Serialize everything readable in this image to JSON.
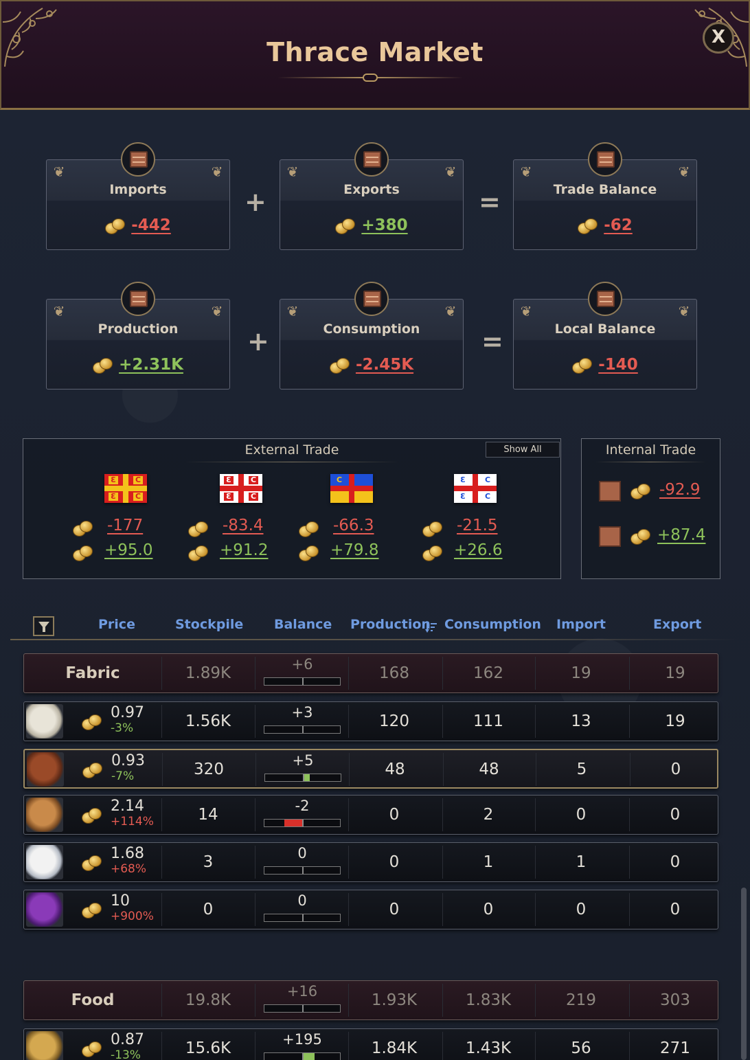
{
  "window": {
    "title": "Thrace Market",
    "close_label": "X"
  },
  "summary": {
    "row1": [
      {
        "label": "Imports",
        "value": "-442",
        "sign": "neg"
      },
      {
        "label": "Exports",
        "value": "+380",
        "sign": "pos"
      },
      {
        "label": "Trade Balance",
        "value": "-62",
        "sign": "neg"
      }
    ],
    "row2": [
      {
        "label": "Production",
        "value": "+2.31K",
        "sign": "pos"
      },
      {
        "label": "Consumption",
        "value": "-2.45K",
        "sign": "neg"
      },
      {
        "label": "Local Balance",
        "value": "-140",
        "sign": "neg"
      }
    ],
    "op_plus": "+",
    "op_equals": "="
  },
  "external_trade": {
    "title": "External Trade",
    "show_all_label": "Show All",
    "partners": [
      {
        "flag": "red-cross-gold-flag",
        "import": "-177",
        "export": "+95.0"
      },
      {
        "flag": "white-cross-red-flag",
        "import": "-83.4",
        "export": "+91.2"
      },
      {
        "flag": "red-cross-blue-yellow-flag",
        "import": "-66.3",
        "export": "+79.8"
      },
      {
        "flag": "red-cross-white-eagle-flag",
        "import": "-21.5",
        "export": "+26.6"
      }
    ]
  },
  "internal_trade": {
    "title": "Internal Trade",
    "import": "-92.9",
    "export": "+87.4"
  },
  "table": {
    "headers": {
      "price": "Price",
      "stockpile": "Stockpile",
      "balance": "Balance",
      "production": "Production",
      "consumption": "Consumption",
      "import": "Import",
      "export": "Export"
    },
    "sort_icon": "sort-descending-icon",
    "rows": [
      {
        "kind": "category",
        "name": "Fabric",
        "stockpile": "1.89K",
        "balance": "+6",
        "production": "168",
        "consumption": "162",
        "import": "19",
        "export": "19",
        "balance_fill": 0
      },
      {
        "kind": "good",
        "icon": "wool-icon",
        "price": "0.97",
        "change": "-3%",
        "change_dir": "down",
        "stockpile": "1.56K",
        "balance": "+3",
        "production": "120",
        "consumption": "111",
        "import": "13",
        "export": "19",
        "balance_fill": 0
      },
      {
        "kind": "good",
        "icon": "leather-icon",
        "price": "0.93",
        "change": "-7%",
        "change_dir": "down",
        "stockpile": "320",
        "balance": "+5",
        "production": "48",
        "consumption": "48",
        "import": "5",
        "export": "0",
        "balance_fill": 0.08,
        "selected": true
      },
      {
        "kind": "good",
        "icon": "fur-icon",
        "price": "2.14",
        "change": "+114%",
        "change_dir": "up",
        "stockpile": "14",
        "balance": "-2",
        "production": "0",
        "consumption": "2",
        "import": "0",
        "export": "0",
        "balance_fill": -0.25
      },
      {
        "kind": "good",
        "icon": "cotton-icon",
        "price": "1.68",
        "change": "+68%",
        "change_dir": "up",
        "stockpile": "3",
        "balance": "0",
        "production": "0",
        "consumption": "1",
        "import": "1",
        "export": "0",
        "balance_fill": 0
      },
      {
        "kind": "good",
        "icon": "silk-icon",
        "price": "10",
        "change": "+900%",
        "change_dir": "up",
        "stockpile": "0",
        "balance": "0",
        "production": "0",
        "consumption": "0",
        "import": "0",
        "export": "0",
        "balance_fill": 0
      },
      {
        "kind": "category",
        "name": "Food",
        "stockpile": "19.8K",
        "balance": "+16",
        "production": "1.93K",
        "consumption": "1.83K",
        "import": "219",
        "export": "303",
        "balance_fill": 0
      },
      {
        "kind": "good",
        "icon": "wheat-icon",
        "price": "0.87",
        "change": "-13%",
        "change_dir": "down",
        "stockpile": "15.6K",
        "balance": "+195",
        "production": "1.84K",
        "consumption": "1.43K",
        "import": "56",
        "export": "271",
        "balance_fill": 0.15
      }
    ]
  },
  "colors": {
    "accent_gold": "#e9c79a",
    "negative": "#e45b52",
    "positive": "#8ec25b",
    "header_blue": "#6f9be0"
  }
}
